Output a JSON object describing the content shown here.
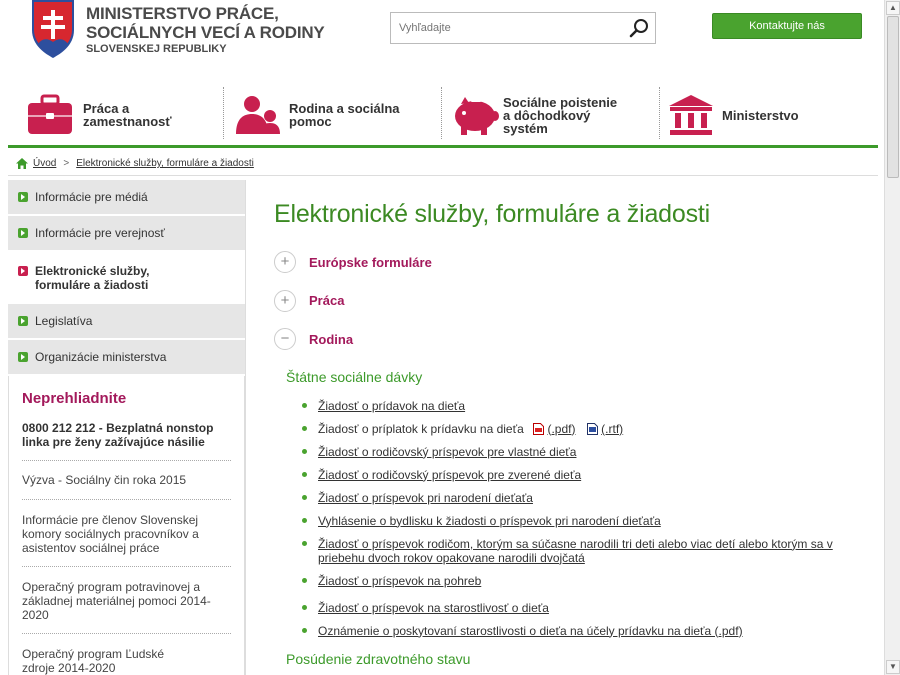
{
  "header": {
    "name_line1": "MINISTERSTVO PRÁCE,",
    "name_line2": "SOCIÁLNYCH VECÍ A RODINY",
    "name_line3": "SLOVENSKEJ REPUBLIKY",
    "search_placeholder": "Vyhľadajte",
    "contact_label": "Kontaktujte nás"
  },
  "mainnav": [
    {
      "line1": "Práca a",
      "line2": "zamestnanosť",
      "line3": "",
      "icon": "briefcase-icon"
    },
    {
      "line1": "Rodina a sociálna",
      "line2": "pomoc",
      "line3": "",
      "icon": "family-icon"
    },
    {
      "line1": "Sociálne poistenie",
      "line2": "a dôchodkový",
      "line3": "systém",
      "icon": "piggy-bank-icon"
    },
    {
      "line1": "Ministerstvo",
      "line2": "",
      "line3": "",
      "icon": "building-icon"
    }
  ],
  "breadcrumb": {
    "home": "Úvod",
    "current": "Elektronické služby, formuláre a žiadosti"
  },
  "sidebar": {
    "items": [
      {
        "label": "Informácie pre médiá"
      },
      {
        "label": "Informácie pre verejnosť"
      },
      {
        "label": "Elektronické služby, formuláre a žiadosti"
      },
      {
        "label": "Legislatíva"
      },
      {
        "label": "Organizácie ministerstva"
      }
    ],
    "highlights_title": "Neprehliadnite",
    "highlights": [
      "0800 212 212 - Bezplatná nonstop linka pre ženy zažívajúce násilie",
      "Výzva - Sociálny čin roka 2015",
      "Informácie pre členov Slovenskej komory sociálnych pracovníkov a asistentov sociálnej práce",
      "Operačný program potravinovej a základnej materiálnej pomoci 2014-2020",
      "Operačný program Ľudské zdroje 2014-2020"
    ]
  },
  "content": {
    "title": "Elektronické služby, formuláre a žiadosti",
    "accordions": [
      {
        "icon": "+",
        "label": "Európske formuláre"
      },
      {
        "icon": "+",
        "label": "Práca"
      },
      {
        "icon": "−",
        "label": "Rodina"
      }
    ],
    "subhead1": "Štátne sociálne dávky",
    "docs": [
      "Žiadosť o prídavok na dieťa",
      "Žiadosť o príplatok k prídavku na dieťa",
      "Žiadosť o rodičovský príspevok pre vlastné dieťa",
      "Žiadosť o rodičovský príspevok pre zverené dieťa",
      "Žiadosť o príspevok pri narodení dieťaťa",
      "Vyhlásenie o bydlisku k žiadosti o príspevok pri narodení dieťaťa",
      "Žiadosť o príspevok rodičom, ktorým sa súčasne narodili tri deti alebo viac detí alebo ktorým sa v priebehu dvoch rokov opakovane narodili dvojčatá",
      "Žiadosť o príspevok na pohreb",
      "Žiadosť o príspevok na starostlivosť o dieťa",
      "Oznámenie o poskytovaní starostlivosti o dieťa na účely prídavku na dieťa (.pdf)"
    ],
    "pdf_link": "(.pdf)",
    "rtf_link": "(.rtf)",
    "subhead2": "Posúdenie zdravotného stavu"
  },
  "colors": {
    "brand_green": "#3c8a23",
    "accent_magenta": "#a3195b",
    "button_green": "#4aa32f"
  }
}
